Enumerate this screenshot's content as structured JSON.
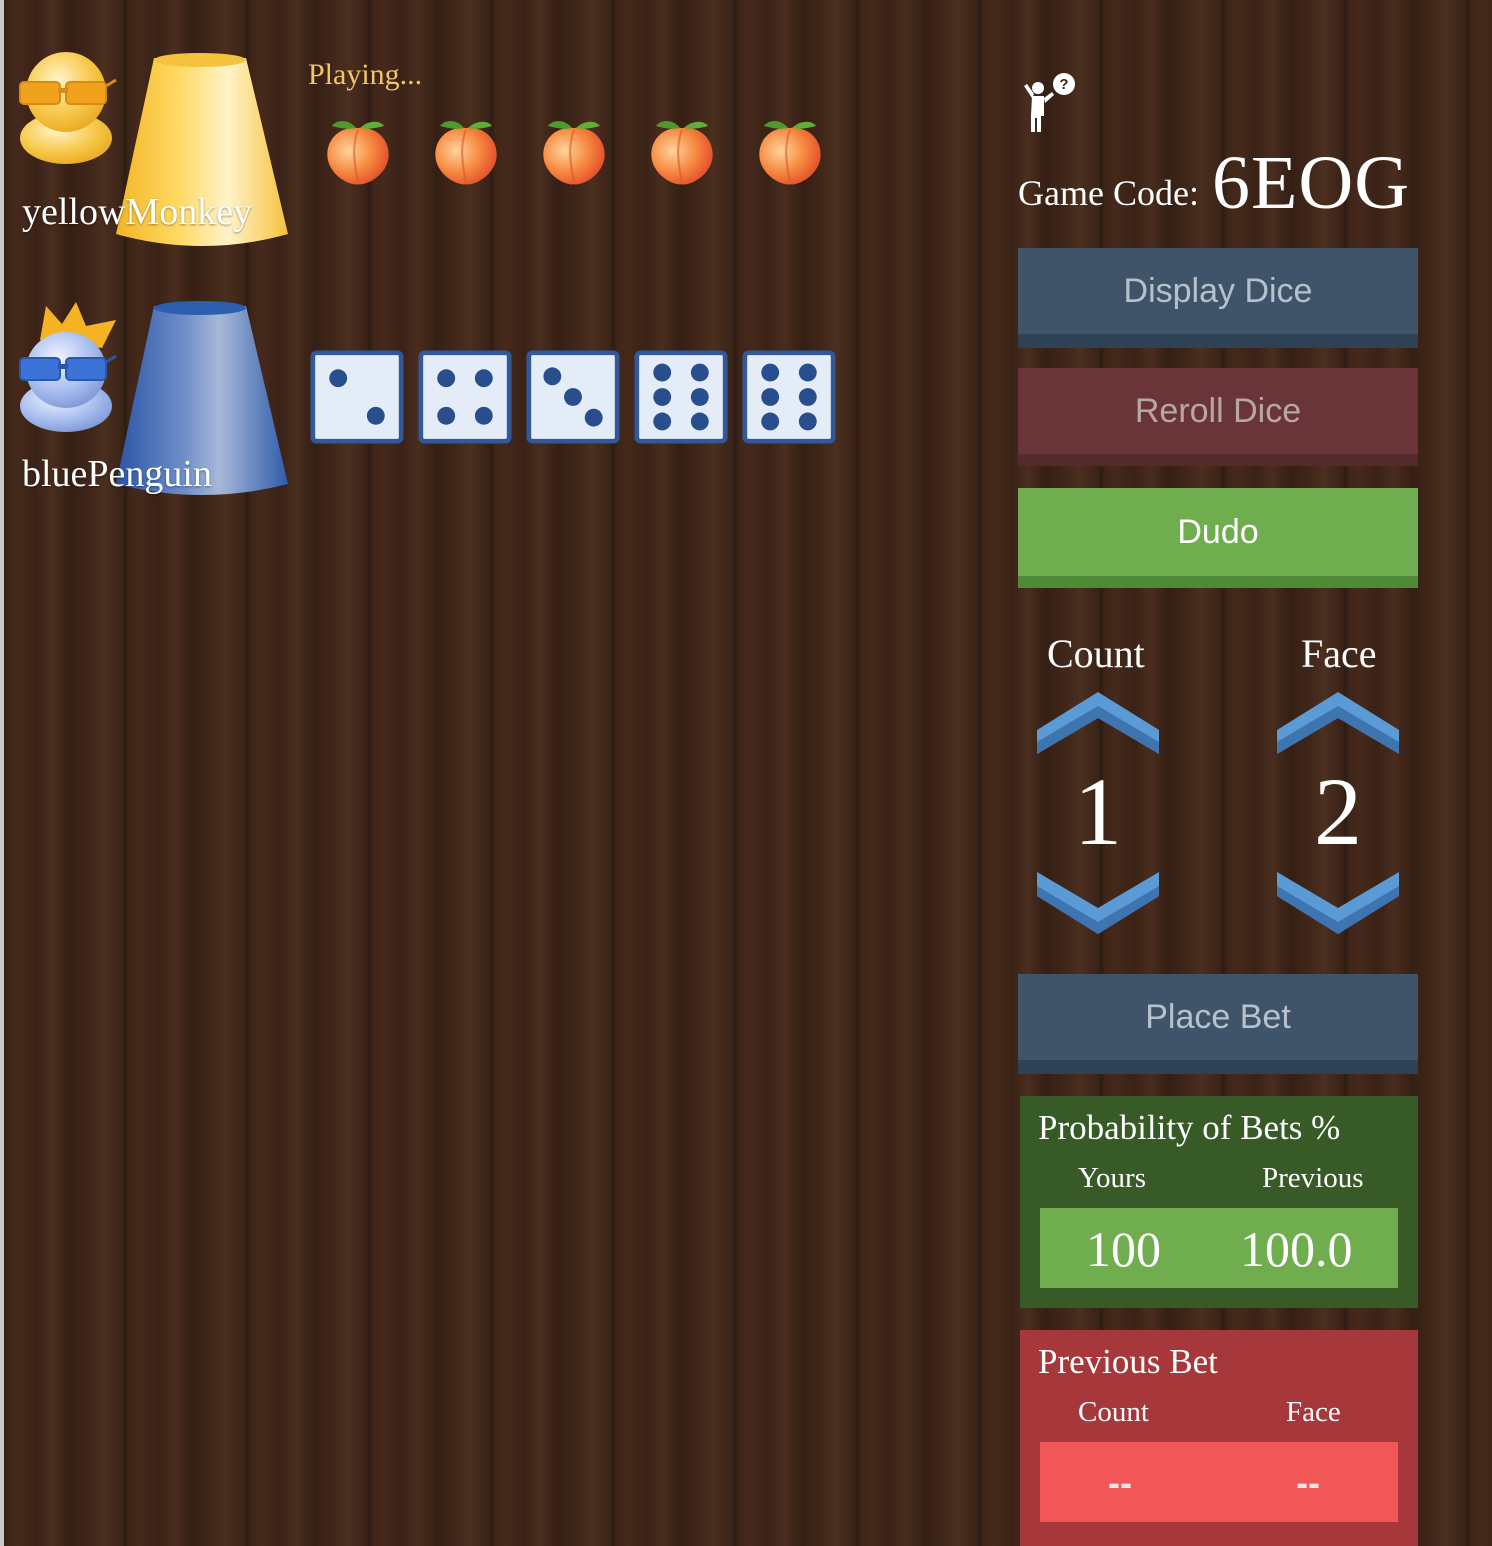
{
  "players": [
    {
      "name": "yellowMonkey",
      "color": "#f5c13c",
      "role": "host"
    },
    {
      "name": "bluePenguin",
      "color": "#2f5ea8",
      "role": "current",
      "crown": true
    }
  ],
  "status": "Playing...",
  "opponent_dice": [
    "peach",
    "peach",
    "peach",
    "peach",
    "peach"
  ],
  "my_dice": [
    2,
    4,
    3,
    6,
    6
  ],
  "game_code": {
    "label": "Game Code:",
    "value": "6EOG"
  },
  "buttons": {
    "display_dice": "Display Dice",
    "reroll_dice": "Reroll Dice",
    "dudo": "Dudo",
    "place_bet": "Place Bet"
  },
  "bet_selector": {
    "count_label": "Count",
    "face_label": "Face",
    "count_value": "1",
    "face_value": "2"
  },
  "probability": {
    "title": "Probability of Bets %",
    "yours_label": "Yours",
    "previous_label": "Previous",
    "yours_value": "100",
    "previous_value": "100.0"
  },
  "previous_bet": {
    "title": "Previous Bet",
    "count_label": "Count",
    "face_label": "Face",
    "count_value": "--",
    "face_value": "--"
  },
  "icons": [
    "help-person-icon",
    "peach-icon",
    "die-icon",
    "chevron-up-icon",
    "chevron-down-icon",
    "crown-icon"
  ],
  "colors": {
    "panel_green": "#375a27",
    "panel_green_box": "#70ad4f",
    "panel_red": "#a6383b",
    "panel_red_box": "#f25757",
    "button_blue": "#3f5469",
    "button_maroon": "#6a3538",
    "button_green": "#70ad4f",
    "arrow_blue": "#5b9bd5",
    "status_gold": "#f3c46a"
  }
}
